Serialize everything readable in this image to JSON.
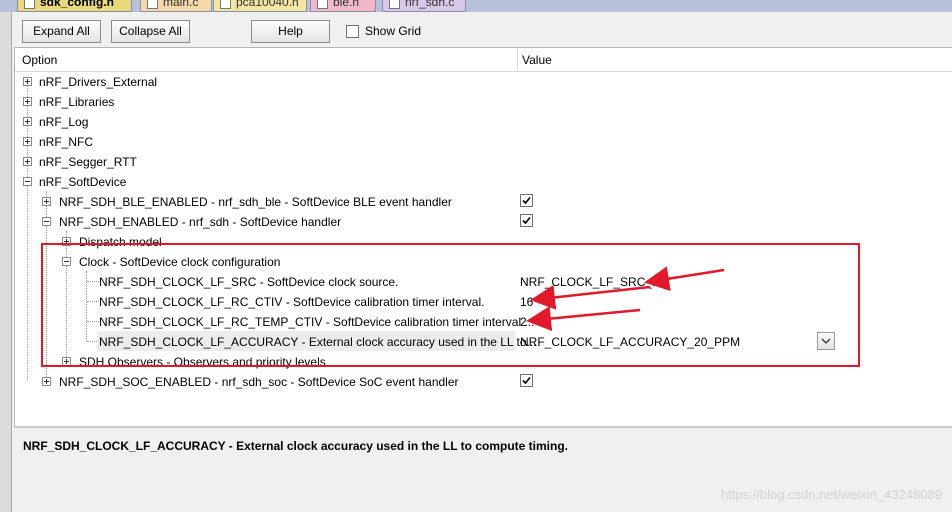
{
  "tabs": [
    {
      "label": "sdk_config.h",
      "active": true
    },
    {
      "label": "main.c",
      "active": false
    },
    {
      "label": "pca10040.h",
      "active": false
    },
    {
      "label": "ble.h",
      "active": false
    },
    {
      "label": "nrf_sdh.c",
      "active": false
    }
  ],
  "toolbar": {
    "expand_all": "Expand All",
    "collapse_all": "Collapse All",
    "help": "Help",
    "show_grid": "Show Grid"
  },
  "grid": {
    "col_option": "Option",
    "col_value": "Value"
  },
  "rows": [
    {
      "label": "nRF_Drivers_External",
      "value": ""
    },
    {
      "label": "nRF_Libraries",
      "value": ""
    },
    {
      "label": "nRF_Log",
      "value": ""
    },
    {
      "label": "nRF_NFC",
      "value": ""
    },
    {
      "label": "nRF_Segger_RTT",
      "value": ""
    },
    {
      "label": "nRF_SoftDevice",
      "value": ""
    },
    {
      "label": "NRF_SDH_BLE_ENABLED - nrf_sdh_ble - SoftDevice BLE event handler",
      "value": "checked"
    },
    {
      "label": "NRF_SDH_ENABLED - nrf_sdh - SoftDevice handler",
      "value": "checked"
    },
    {
      "label": "Dispatch model",
      "value": ""
    },
    {
      "label": "Clock - SoftDevice clock configuration",
      "value": ""
    },
    {
      "label": "NRF_SDH_CLOCK_LF_SRC  - SoftDevice clock source.",
      "value": "NRF_CLOCK_LF_SRC_RC"
    },
    {
      "label": "NRF_SDH_CLOCK_LF_RC_CTIV - SoftDevice calibration timer interval.",
      "value": "16"
    },
    {
      "label": "NRF_SDH_CLOCK_LF_RC_TEMP_CTIV - SoftDevice calibration timer interval ...",
      "value": "2"
    },
    {
      "label": "NRF_SDH_CLOCK_LF_ACCURACY  - External clock accuracy used in the LL to...",
      "value": "NRF_CLOCK_LF_ACCURACY_20_PPM"
    },
    {
      "label": "SDH Observers - Observers and priority levels",
      "value": ""
    },
    {
      "label": "NRF_SDH_SOC_ENABLED - nrf_sdh_soc - SoftDevice SoC event handler",
      "value": "checked"
    }
  ],
  "description": {
    "title": "NRF_SDH_CLOCK_LF_ACCURACY  - External clock accuracy used in the LL to compute timing."
  },
  "watermark": "https://blog.csdn.net/weixin_43248089",
  "colors": {
    "highlight_box": "#e0192b",
    "active_tab": "#e8d97a"
  }
}
